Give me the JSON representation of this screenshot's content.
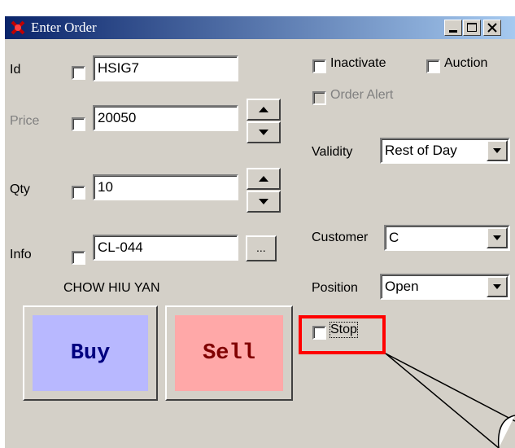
{
  "window": {
    "title": "Enter Order"
  },
  "fields": {
    "id": {
      "label": "Id",
      "value": "HSIG7"
    },
    "price": {
      "label": "Price",
      "value": "20050"
    },
    "qty": {
      "label": "Qty",
      "value": "10"
    },
    "info": {
      "label": "Info",
      "value": "CL-044",
      "browse_label": "...",
      "client_name": "CHOW HIU YAN"
    }
  },
  "options": {
    "inactivate_label": "Inactivate",
    "auction_label": "Auction",
    "order_alert_label": "Order Alert",
    "stop_label": "Stop"
  },
  "validity": {
    "label": "Validity",
    "value": "Rest of Day"
  },
  "customer": {
    "label": "Customer",
    "value": "C"
  },
  "position": {
    "label": "Position",
    "value": "Open"
  },
  "buttons": {
    "buy": "Buy",
    "sell": "Sell"
  },
  "colors": {
    "buy_face": "#b8b8ff",
    "buy_text": "#000080",
    "sell_face": "#ffa8a8",
    "sell_text": "#800000",
    "highlight": "#ff0000"
  }
}
